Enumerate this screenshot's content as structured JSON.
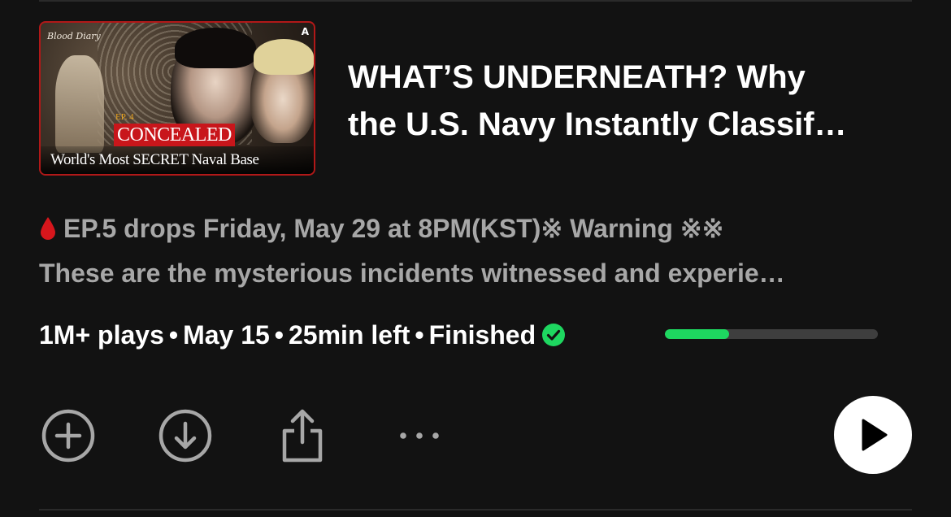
{
  "episode": {
    "thumbnail": {
      "brand": "Blood Diary",
      "corner_mark": "A",
      "episode_label": "EP. 4",
      "tag": "CONCEALED",
      "subtitle": "World's Most SECRET Naval Base"
    },
    "title_line1": "WHAT’S UNDERNEATH? Why",
    "title_line2": "the U.S. Navy Instantly Classif…",
    "description_line1": "EP.5 drops Friday, May 29 at 8PM(KST)※ Warning ※※",
    "description_line2": "These are the mysterious incidents witnessed and experie…",
    "meta": {
      "plays": "1M+ plays",
      "separator": "•",
      "date": "May 15",
      "time_left": "25min left",
      "status": "Finished"
    },
    "progress_fraction": 0.3
  },
  "actions": {
    "add_icon": "plus-circle-icon",
    "download_icon": "download-circle-icon",
    "share_icon": "share-icon",
    "more_icon": "ellipsis-icon",
    "play_icon": "play-icon"
  },
  "colors": {
    "background": "#121212",
    "accent_green": "#1ed760",
    "text_secondary": "#a7a7a7",
    "progress_track": "#3e3e3e"
  }
}
